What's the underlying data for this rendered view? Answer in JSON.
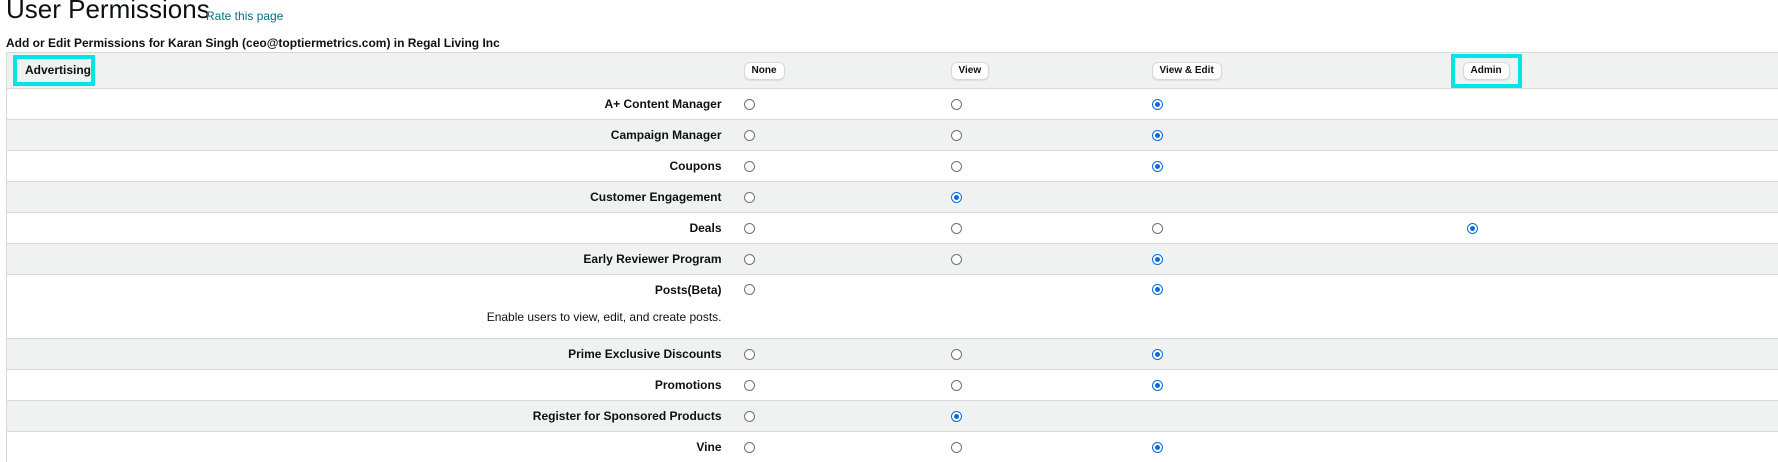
{
  "header": {
    "title": "User Permissions",
    "rate_link": "Rate this page",
    "subtitle": "Add or Edit Permissions for Karan Singh (ceo@toptiermetrics.com) in Regal Living Inc"
  },
  "section": {
    "label": "Advertising",
    "columns": [
      "None",
      "View",
      "View & Edit",
      "Admin"
    ]
  },
  "rows": [
    {
      "name": "A+ Content Manager",
      "options": [
        true,
        true,
        true,
        false
      ],
      "selected": 2,
      "shaded": false
    },
    {
      "name": "Campaign Manager",
      "options": [
        true,
        true,
        true,
        false
      ],
      "selected": 2,
      "shaded": true
    },
    {
      "name": "Coupons",
      "options": [
        true,
        true,
        true,
        false
      ],
      "selected": 2,
      "shaded": false
    },
    {
      "name": "Customer Engagement",
      "options": [
        true,
        true,
        false,
        false
      ],
      "selected": 1,
      "shaded": true
    },
    {
      "name": "Deals",
      "options": [
        true,
        true,
        true,
        true
      ],
      "selected": 3,
      "shaded": false
    },
    {
      "name": "Early Reviewer Program",
      "options": [
        true,
        true,
        true,
        false
      ],
      "selected": 2,
      "shaded": true
    },
    {
      "name": "Posts(Beta)",
      "description": "Enable users to view, edit, and create posts.",
      "options": [
        true,
        false,
        true,
        false
      ],
      "selected": 2,
      "shaded": false
    },
    {
      "name": "Prime Exclusive Discounts",
      "options": [
        true,
        true,
        true,
        false
      ],
      "selected": 2,
      "shaded": true
    },
    {
      "name": "Promotions",
      "options": [
        true,
        true,
        true,
        false
      ],
      "selected": 2,
      "shaded": false
    },
    {
      "name": "Register for Sponsored Products",
      "options": [
        true,
        true,
        false,
        false
      ],
      "selected": 1,
      "shaded": true
    },
    {
      "name": "Vine",
      "options": [
        true,
        true,
        true,
        false
      ],
      "selected": 2,
      "shaded": false
    }
  ],
  "colors": {
    "accent_highlight": "#00e5e8",
    "radio_selected": "#0b6bde",
    "shade": "#f0f2f2",
    "link": "#007185"
  }
}
